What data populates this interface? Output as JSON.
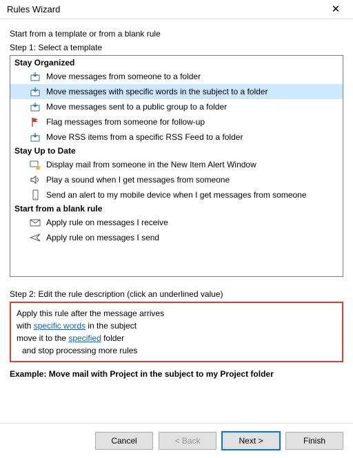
{
  "title": "Rules Wizard",
  "intro": "Start from a template or from a blank rule",
  "step1_label": "Step 1: Select a template",
  "sections": {
    "organized": {
      "header": "Stay Organized",
      "items": [
        "Move messages from someone to a folder",
        "Move messages with specific words in the subject to a folder",
        "Move messages sent to a public group to a folder",
        "Flag messages from someone for follow-up",
        "Move RSS items from a specific RSS Feed to a folder"
      ]
    },
    "uptodate": {
      "header": "Stay Up to Date",
      "items": [
        "Display mail from someone in the New Item Alert Window",
        "Play a sound when I get messages from someone",
        "Send an alert to my mobile device when I get messages from someone"
      ]
    },
    "blank": {
      "header": "Start from a blank rule",
      "items": [
        "Apply rule on messages I receive",
        "Apply rule on messages I send"
      ]
    }
  },
  "step2_label": "Step 2: Edit the rule description (click an underlined value)",
  "description": {
    "line1": "Apply this rule after the message arrives",
    "line2_pre": "with ",
    "line2_link": "specific words",
    "line2_post": " in the subject",
    "line3_pre": "move it to the ",
    "line3_link": "specified",
    "line3_post": " folder",
    "line4": "and stop processing more rules"
  },
  "example": "Example: Move mail with Project in the subject to my Project folder",
  "buttons": {
    "cancel": "Cancel",
    "back": "< Back",
    "next": "Next >",
    "finish": "Finish"
  }
}
